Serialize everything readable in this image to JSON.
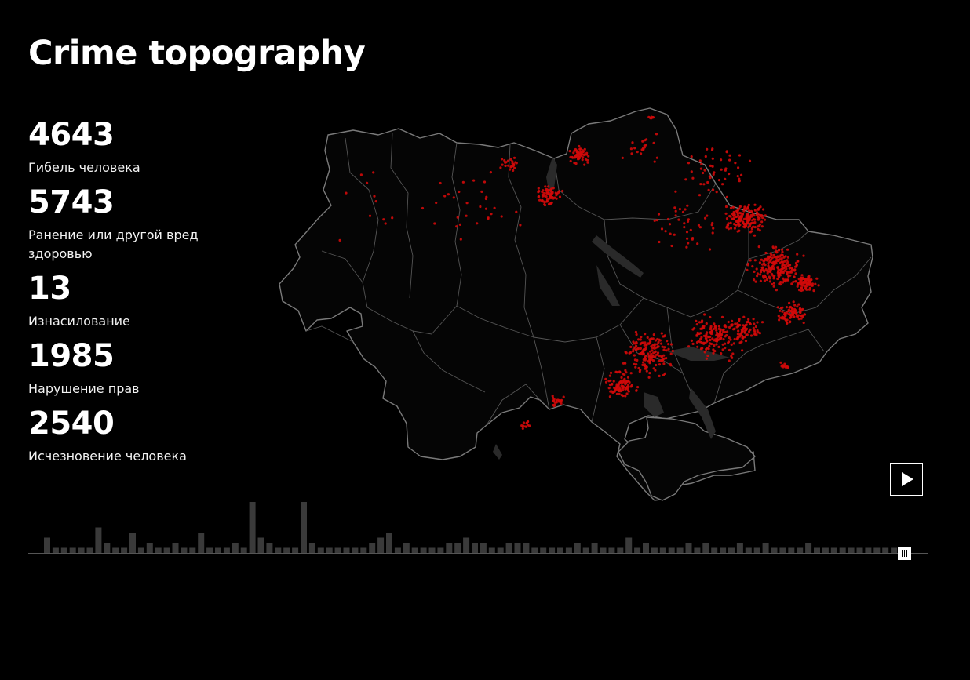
{
  "title": "Crime topography",
  "stats": [
    {
      "value": "4643",
      "label": "Гибель человека"
    },
    {
      "value": "5743",
      "label": "Ранение или другой вред здоровью"
    },
    {
      "value": "13",
      "label": "Изнасилование"
    },
    {
      "value": "1985",
      "label": "Нарушение прав"
    },
    {
      "value": "2540",
      "label": "Исчезновение человека"
    }
  ],
  "colors": {
    "background": "#000000",
    "text": "#ffffff",
    "incident_dot": "#d10a0a",
    "border": "#7a7a7a",
    "timeline_bar": "#3a3a3a"
  },
  "controls": {
    "play_icon": "play-icon",
    "scrubber_icon": "scrubber-handle-icon",
    "scrubber_position": 1.0
  },
  "timeline_counts": [
    3,
    1,
    1,
    1,
    1,
    1,
    5,
    2,
    1,
    1,
    4,
    1,
    2,
    1,
    1,
    2,
    1,
    1,
    4,
    1,
    1,
    1,
    2,
    1,
    10,
    3,
    2,
    1,
    1,
    1,
    10,
    2,
    1,
    1,
    1,
    1,
    1,
    1,
    2,
    3,
    4,
    1,
    2,
    1,
    1,
    1,
    1,
    2,
    2,
    3,
    2,
    2,
    1,
    1,
    2,
    2,
    2,
    1,
    1,
    1,
    1,
    1,
    2,
    1,
    2,
    1,
    1,
    1,
    3,
    1,
    2,
    1,
    1,
    1,
    1,
    2,
    1,
    2,
    1,
    1,
    1,
    2,
    1,
    1,
    2,
    1,
    1,
    1,
    1,
    2,
    1,
    1,
    1,
    1,
    1,
    1,
    1,
    1,
    1,
    1
  ]
}
